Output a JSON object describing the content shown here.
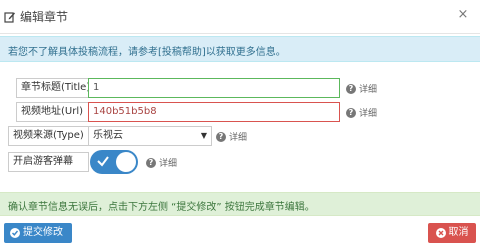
{
  "dialog": {
    "title": "编辑章节",
    "close_symbol": "×"
  },
  "info_alert": {
    "text_before": "若您不了解具体投稿流程，请参考",
    "link": "[投稿帮助]",
    "text_after": "以获取更多信息。"
  },
  "form": {
    "chapter_title": {
      "label": "章节标题(Title)",
      "value": "1"
    },
    "video_url": {
      "label": "视频地址(Url)",
      "value": "140b51b5b8"
    },
    "video_source": {
      "label": "视频来源(Type)",
      "value": "乐视云"
    },
    "danmaku": {
      "label": "开启游客弹幕",
      "enabled": true
    },
    "help_text": "详细"
  },
  "success_alert": {
    "text": "确认章节信息无误后，点击下方左侧 “提交修改” 按钮完成章节编辑。"
  },
  "buttons": {
    "submit": "提交修改",
    "cancel": "取消"
  },
  "colors": {
    "primary": "#3a87c8",
    "danger": "#d9534f",
    "success_border": "#5cb85c",
    "info_bg": "#d9edf7",
    "success_bg": "#dff0d8"
  },
  "icons": {
    "title": "edit-icon",
    "help": "question-circle-icon",
    "submit": "check-circle-icon",
    "cancel": "close-circle-icon"
  }
}
